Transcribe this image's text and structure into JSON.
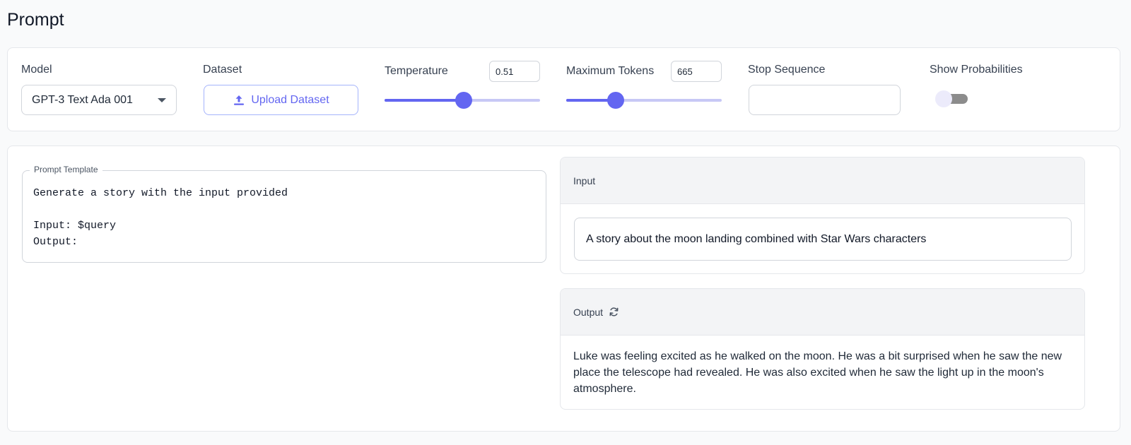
{
  "page": {
    "title": "Prompt"
  },
  "toolbar": {
    "model": {
      "label": "Model",
      "selected": "GPT-3 Text Ada 001"
    },
    "dataset": {
      "label": "Dataset",
      "button_label": "Upload Dataset"
    },
    "temperature": {
      "label": "Temperature",
      "value": "0.51",
      "level": 0.51
    },
    "max_tokens": {
      "label": "Maximum Tokens",
      "value": "665",
      "level": 0.32
    },
    "stop_sequence": {
      "label": "Stop Sequence",
      "value": ""
    },
    "show_probabilities": {
      "label": "Show Probabilities",
      "enabled": false
    }
  },
  "template": {
    "legend": "Prompt Template",
    "text": "Generate a story with the input provided\n\nInput: $query\nOutput:"
  },
  "input_panel": {
    "title": "Input",
    "value": "A story about the moon landing combined with Star Wars characters"
  },
  "output_panel": {
    "title": "Output",
    "text": "Luke was feeling excited as he walked on the moon. He was a bit surprised when he saw the new place the telescope had revealed. He was also excited when he saw the light up in the moon's atmosphere."
  },
  "colors": {
    "accent": "#6366f1",
    "accent_light": "#c7c8f5",
    "border": "#d1d5db"
  },
  "icons": {
    "model_dropdown": "chevron-down-icon",
    "upload": "upload-icon",
    "output_refresh": "refresh-icon"
  }
}
